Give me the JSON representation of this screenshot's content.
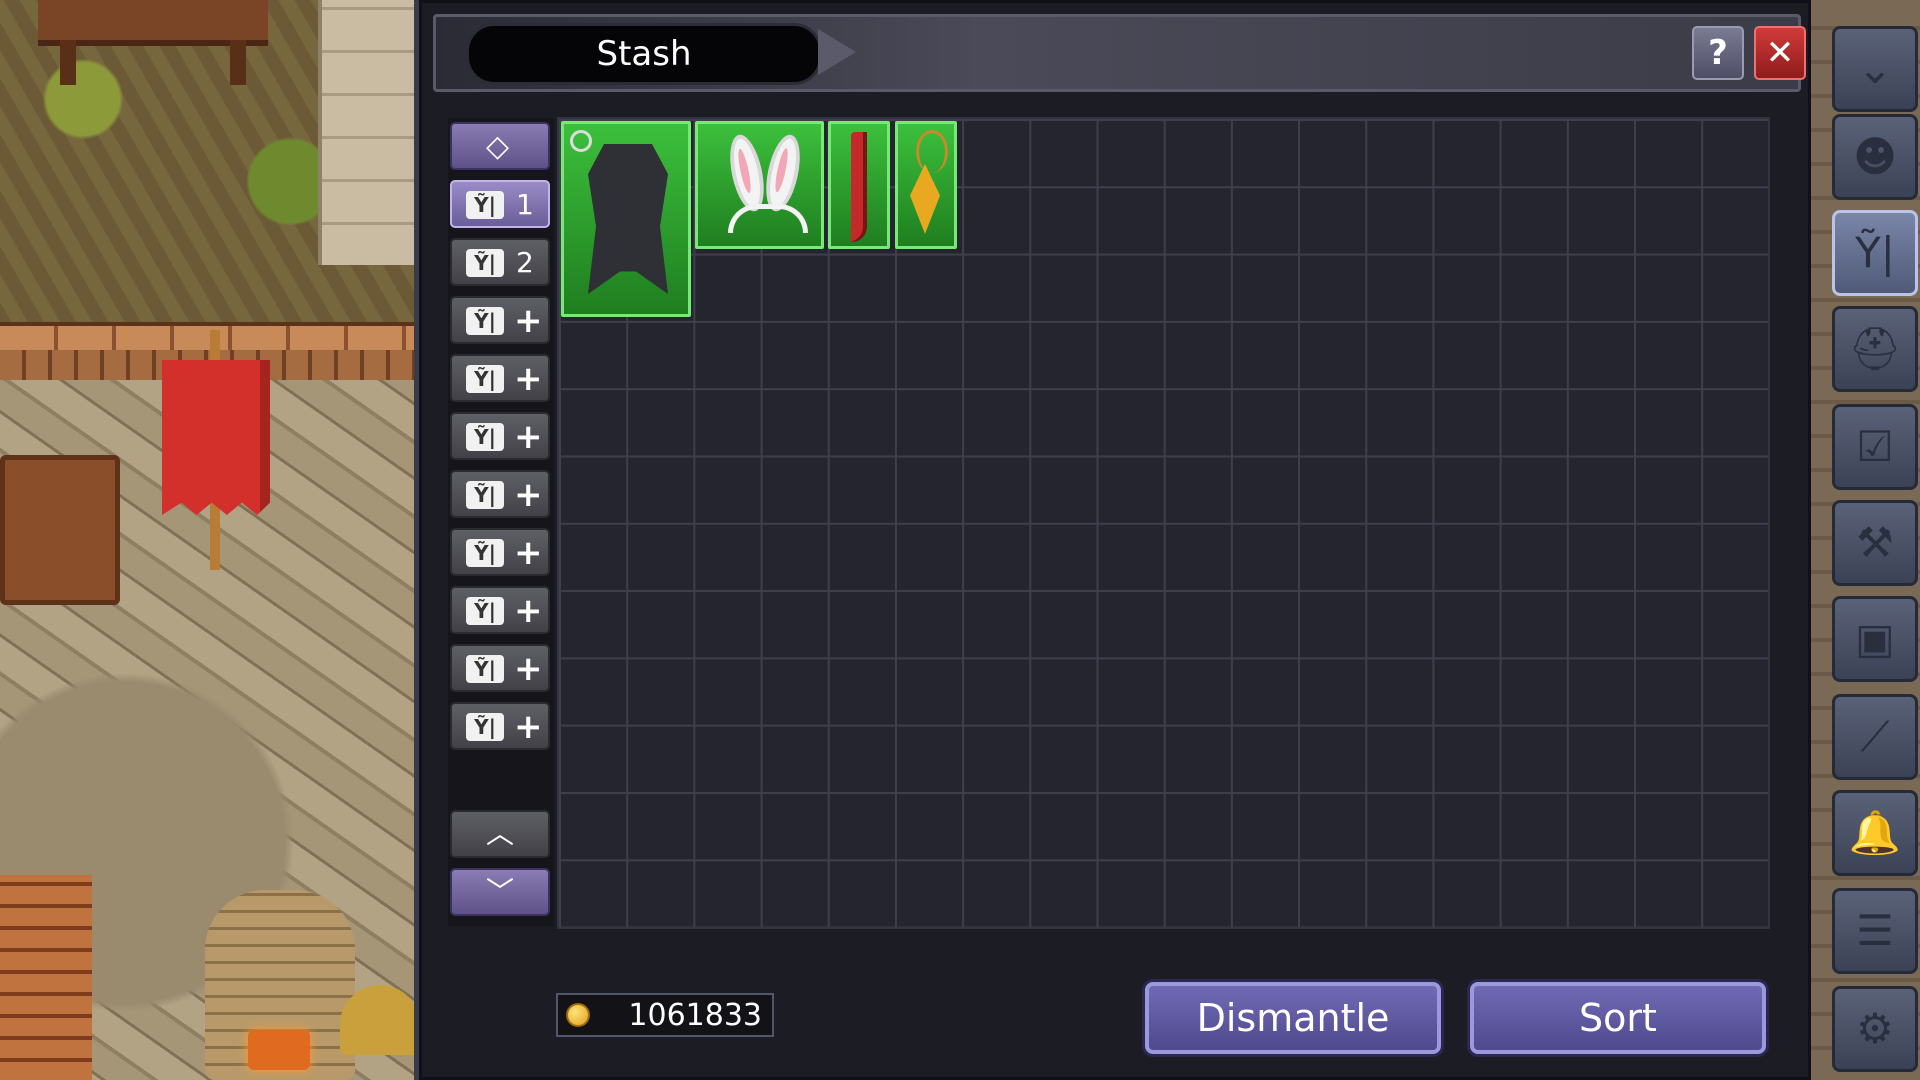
{
  "window": {
    "title": "Stash",
    "help_label": "?",
    "close_label": "✕"
  },
  "tabs": [
    {
      "kind": "special",
      "icon": "diamond-icon",
      "glyph": "◇"
    },
    {
      "kind": "numbered",
      "label": "1",
      "icon": "stash-tab-icon",
      "glyph": "Ỹ|"
    },
    {
      "kind": "numbered",
      "label": "2",
      "icon": "stash-tab-icon",
      "glyph": "Ỹ|"
    },
    {
      "kind": "add",
      "label": "+",
      "glyph": "Ỹ|"
    },
    {
      "kind": "add",
      "label": "+",
      "glyph": "Ỹ|"
    },
    {
      "kind": "add",
      "label": "+",
      "glyph": "Ỹ|"
    },
    {
      "kind": "add",
      "label": "+",
      "glyph": "Ỹ|"
    },
    {
      "kind": "add",
      "label": "+",
      "glyph": "Ỹ|"
    },
    {
      "kind": "add",
      "label": "+",
      "glyph": "Ỹ|"
    },
    {
      "kind": "add",
      "label": "+",
      "glyph": "Ỹ|"
    },
    {
      "kind": "add",
      "label": "+",
      "glyph": "Ỹ|"
    }
  ],
  "scroll": {
    "up_glyph": "︿",
    "down_glyph": "﹀"
  },
  "items": [
    {
      "name": "armor",
      "icon": "chest-armor-icon",
      "rarity_color": "#3cc03c"
    },
    {
      "name": "bunny-ears",
      "icon": "bunny-ears-headband-icon",
      "rarity_color": "#3cc03c"
    },
    {
      "name": "dagger",
      "icon": "red-dagger-icon",
      "rarity_color": "#3cc03c"
    },
    {
      "name": "amulet",
      "icon": "gold-amulet-icon",
      "rarity_color": "#3cc03c"
    }
  ],
  "gold": {
    "icon": "gold-coin-icon",
    "amount": "1061833"
  },
  "buttons": {
    "dismantle": "Dismantle",
    "sort": "Sort"
  },
  "sidebar": [
    {
      "icon": "chevron-down-icon",
      "glyph": "⌄"
    },
    {
      "icon": "character-icon",
      "glyph": "☻"
    },
    {
      "icon": "stash-icon",
      "glyph": "Ỹ|",
      "active": true
    },
    {
      "icon": "helmet-icon",
      "glyph": "⛑"
    },
    {
      "icon": "quest-board-icon",
      "glyph": "☑"
    },
    {
      "icon": "anvil-icon",
      "glyph": "⚒"
    },
    {
      "icon": "container-icon",
      "glyph": "▣"
    },
    {
      "icon": "wand-icon",
      "glyph": "⟋"
    },
    {
      "icon": "bell-icon",
      "glyph": "🔔"
    },
    {
      "icon": "list-icon",
      "glyph": "☰"
    },
    {
      "icon": "settings-gear-icon",
      "glyph": "⚙"
    }
  ]
}
